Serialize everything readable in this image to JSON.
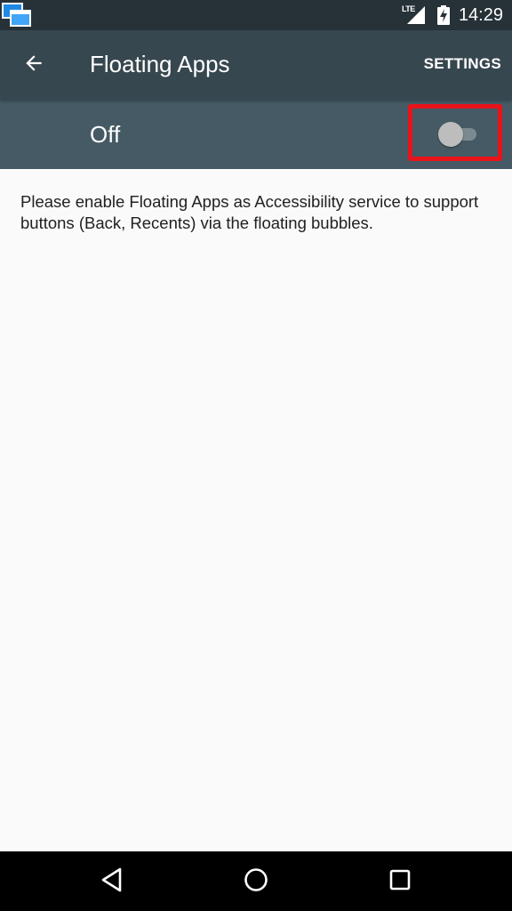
{
  "status_bar": {
    "app_icon": "floating-windows-icon",
    "network_label": "LTE",
    "signal_icon": "signal-icon",
    "battery_icon": "battery-charging-icon",
    "time": "14:29"
  },
  "toolbar": {
    "back_icon": "arrow-back-icon",
    "title": "Floating Apps",
    "settings_label": "SETTINGS"
  },
  "switch_bar": {
    "label": "Off",
    "state": false
  },
  "content": {
    "description": "Please enable Floating Apps as Accessibility service to support buttons (Back, Recents) via the floating bubbles."
  },
  "nav_bar": {
    "back_icon": "nav-back-icon",
    "home_icon": "nav-home-icon",
    "recents_icon": "nav-recents-icon"
  },
  "colors": {
    "status_bar": "#263238",
    "toolbar": "#37474f",
    "switch_bar": "#455a64",
    "highlight": "#e8141c",
    "background": "#fafafa"
  }
}
